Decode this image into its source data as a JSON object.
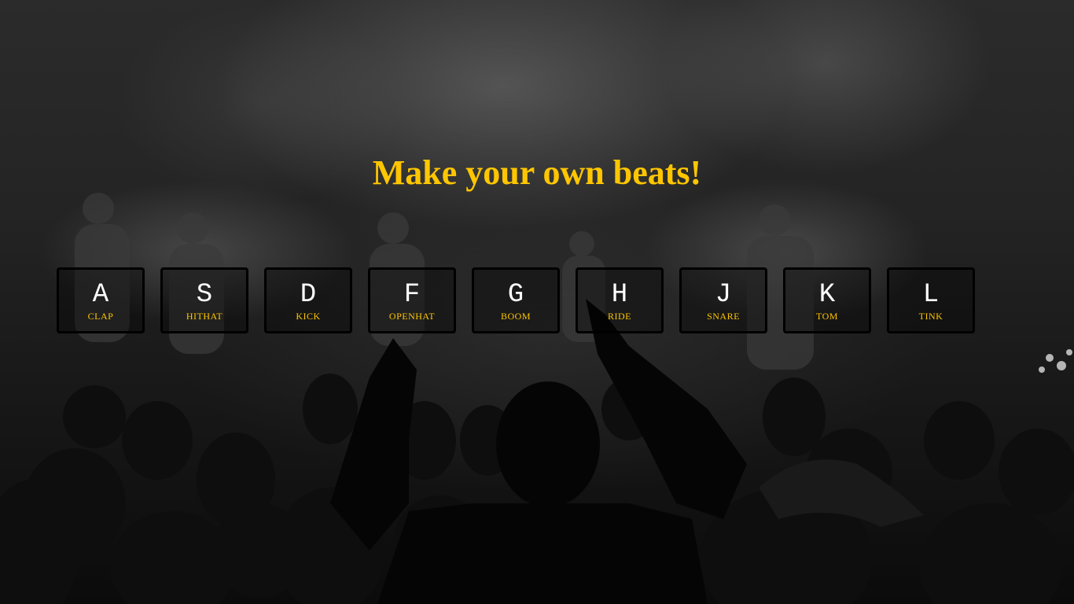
{
  "page": {
    "title": "Make your own beats!"
  },
  "colors": {
    "accent": "#ffc600",
    "key_text": "#ffffff",
    "key_border": "#000000"
  },
  "keys": [
    {
      "key": "A",
      "sound": "CLAP"
    },
    {
      "key": "S",
      "sound": "HITHAT"
    },
    {
      "key": "D",
      "sound": "KICK"
    },
    {
      "key": "F",
      "sound": "OPENHAT"
    },
    {
      "key": "G",
      "sound": "BOOM"
    },
    {
      "key": "H",
      "sound": "RIDE"
    },
    {
      "key": "J",
      "sound": "SNARE"
    },
    {
      "key": "K",
      "sound": "TOM"
    },
    {
      "key": "L",
      "sound": "TINK"
    }
  ]
}
